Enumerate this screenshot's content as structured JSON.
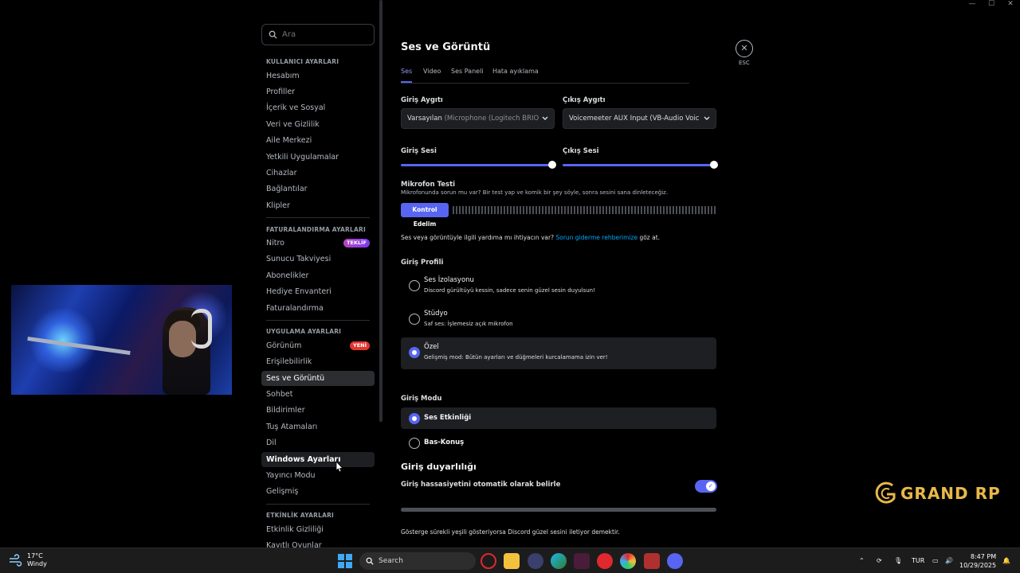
{
  "sidebar": {
    "search_placeholder": "Ara",
    "sections": {
      "user": "KULLANICI AYARLARI",
      "billing": "FATURALANDIRMA AYARLARI",
      "app": "UYGULAMA AYARLARI",
      "activity": "ETKİNLİK AYARLARI"
    },
    "items": {
      "hesabim": "Hesabım",
      "profiller": "Profiller",
      "icerik": "İçerik ve Sosyal",
      "veri": "Veri ve Gizlilik",
      "aile": "Aile Merkezi",
      "yetkili": "Yetkili Uygulamalar",
      "cihazlar": "Cihazlar",
      "baglantilar": "Bağlantılar",
      "klipler": "Klipler",
      "nitro": "Nitro",
      "sunucu": "Sunucu Takviyesi",
      "abonelikler": "Abonelikler",
      "hediye": "Hediye Envanteri",
      "faturalandirma": "Faturalandırma",
      "gorunum": "Görünüm",
      "erisilebilirlik": "Erişilebilirlik",
      "ses_goruntu": "Ses ve Görüntü",
      "sohbet": "Sohbet",
      "bildirimler": "Bildirimler",
      "tus": "Tuş Atamaları",
      "dil": "Dil",
      "windows": "Windows Ayarları",
      "yayinci": "Yayıncı Modu",
      "gelismis": "Gelişmiş",
      "etkinlik_gizliligi": "Etkinlik Gizliliği",
      "kayitli_oyunlar": "Kayıtlı Oyunlar"
    },
    "badges": {
      "teklif": "TEKLİF",
      "yeni": "YENİ"
    }
  },
  "main": {
    "title": "Ses ve Görüntü",
    "tabs": [
      "Ses",
      "Video",
      "Ses Paneli",
      "Hata ayıklama"
    ],
    "input_device_label": "Giriş Aygıtı",
    "input_device_value": "Varsayılan",
    "input_device_detail": "(Microphone (Logitech BRIO",
    "output_device_label": "Çıkış Aygıtı",
    "output_device_value": "Voicemeeter AUX Input (VB-Audio Voic",
    "input_volume_label": "Giriş Sesi",
    "input_volume": 1.0,
    "output_volume_label": "Çıkış Sesi",
    "output_volume": 1.0,
    "mic_test_title": "Mikrofon Testi",
    "mic_test_desc": "Mikrofonunda sorun mu var? Bir test yap ve komik bir şey söyle, sonra sesini sana dinleteceğiz.",
    "mic_test_button": "Kontrol Edelim",
    "help_prefix": "Ses veya görüntüyle ilgili yardıma mı ihtiyacın var?",
    "help_link": "Sorun giderme rehberimize",
    "help_suffix": "göz at.",
    "profile_label": "Giriş Profili",
    "profiles": [
      {
        "title": "Ses İzolasyonu",
        "desc": "Discord gürültüyü kessin, sadece senin güzel sesin duyulsun!"
      },
      {
        "title": "Stüdyo",
        "desc": "Saf ses: İşlemesiz açık mikrofon"
      },
      {
        "title": "Özel",
        "desc": "Gelişmiş mod: Bütün ayarları ve düğmeleri kurcalamama izin ver!"
      }
    ],
    "mode_label": "Giriş Modu",
    "modes": [
      "Ses Etkinliği",
      "Bas-Konuş"
    ],
    "sensitivity_title": "Giriş duyarlılığı",
    "sensitivity_auto": "Giriş hassasiyetini otomatik olarak belirle",
    "sensitivity_note": "Gösterge sürekli yeşili gösteriyorsa Discord güzel sesini iletiyor demektir.",
    "close_label": "ESC"
  },
  "overlay": {
    "brand": "GRAND RP"
  },
  "taskbar": {
    "temperature": "17°C",
    "weather": "Windy",
    "search": "Search",
    "language": "TUR",
    "time": "8:47 PM",
    "date": "10/29/2025"
  },
  "colors": {
    "accent": "#5865f2",
    "link": "#00a8fc",
    "badge_new": "#e0362f",
    "brand": "#e8b84a"
  }
}
